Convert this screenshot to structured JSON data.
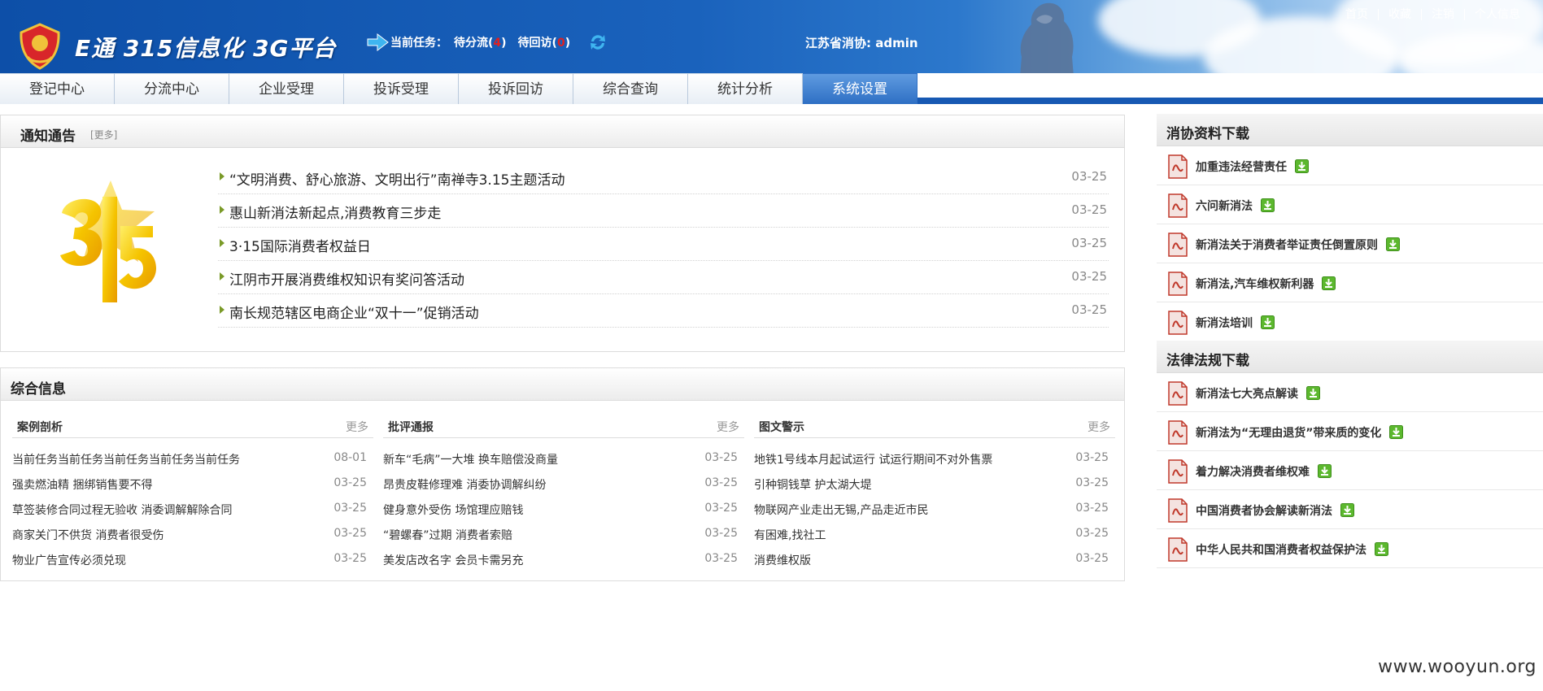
{
  "header": {
    "logo_text": "E通 315信息化 3G平台",
    "task_label": "当前任务：",
    "task_pending_label": "待分流(",
    "task_pending_count": "4",
    "task_revisit_label": "待回访(",
    "task_revisit_count": "0",
    "close_paren": ")",
    "user_label": "江苏省消协: admin",
    "top_links": [
      "首页",
      "收藏",
      "注销",
      "个人信息"
    ]
  },
  "nav": {
    "tabs": [
      "登记中心",
      "分流中心",
      "企业受理",
      "投诉受理",
      "投诉回访",
      "综合查询",
      "统计分析",
      "系统设置"
    ],
    "active_index": 7
  },
  "notice": {
    "title": "通知通告",
    "more": "[更多]",
    "items": [
      {
        "text": "“文明消费、舒心旅游、文明出行”南禅寺3.15主题活动",
        "date": "03-25"
      },
      {
        "text": "惠山新消法新起点,消费教育三步走",
        "date": "03-25"
      },
      {
        "text": "3·15国际消费者权益日",
        "date": "03-25"
      },
      {
        "text": "江阴市开展消费维权知识有奖问答活动",
        "date": "03-25"
      },
      {
        "text": "南长规范辖区电商企业“双十一”促销活动",
        "date": "03-25"
      }
    ]
  },
  "info": {
    "title": "综合信息",
    "columns": [
      {
        "title": "案例剖析",
        "more": "更多",
        "rows": [
          {
            "text": "当前任务当前任务当前任务当前任务当前任务",
            "date": "08-01"
          },
          {
            "text": "强卖燃油精 捆绑销售要不得",
            "date": "03-25"
          },
          {
            "text": "草签装修合同过程无验收 消委调解解除合同",
            "date": "03-25"
          },
          {
            "text": "商家关门不供货 消费者很受伤",
            "date": "03-25"
          },
          {
            "text": "物业广告宣传必须兑现",
            "date": "03-25"
          }
        ]
      },
      {
        "title": "批评通报",
        "more": "更多",
        "rows": [
          {
            "text": "新车“毛病”一大堆 换车赔偿没商量",
            "date": "03-25"
          },
          {
            "text": "昂贵皮鞋修理难 消委协调解纠纷",
            "date": "03-25"
          },
          {
            "text": "健身意外受伤 场馆理应赔钱",
            "date": "03-25"
          },
          {
            "text": "“碧螺春”过期 消费者索赔",
            "date": "03-25"
          },
          {
            "text": "美发店改名字 会员卡需另充",
            "date": "03-25"
          }
        ]
      },
      {
        "title": "图文警示",
        "more": "更多",
        "rows": [
          {
            "text": "地铁1号线本月起试运行 试运行期间不对外售票",
            "date": "03-25"
          },
          {
            "text": "引种铜钱草 护太湖大堤",
            "date": "03-25"
          },
          {
            "text": "物联网产业走出无锡,产品走近市民",
            "date": "03-25"
          },
          {
            "text": "有困难,找社工",
            "date": "03-25"
          },
          {
            "text": "消费维权版",
            "date": "03-25"
          }
        ]
      }
    ]
  },
  "downloads": {
    "consumer_title": "消协资料下载",
    "consumer_items": [
      "加重违法经营责任",
      "六问新消法",
      "新消法关于消费者举证责任倒置原则",
      "新消法,汽车维权新利器",
      "新消法培训"
    ],
    "law_title": "法律法规下载",
    "law_items": [
      "新消法七大亮点解读",
      "新消法为“无理由退货”带来质的变化",
      "着力解决消费者维权难",
      "中国消费者协会解读新消法",
      "中华人民共和国消费者权益保护法"
    ]
  },
  "watermark": "www.wooyun.org",
  "colors": {
    "nav_active": "#2e6fc4",
    "header_blue": "#1a62bc",
    "download_green": "#5cb82e",
    "doc_red": "#c0392b"
  }
}
